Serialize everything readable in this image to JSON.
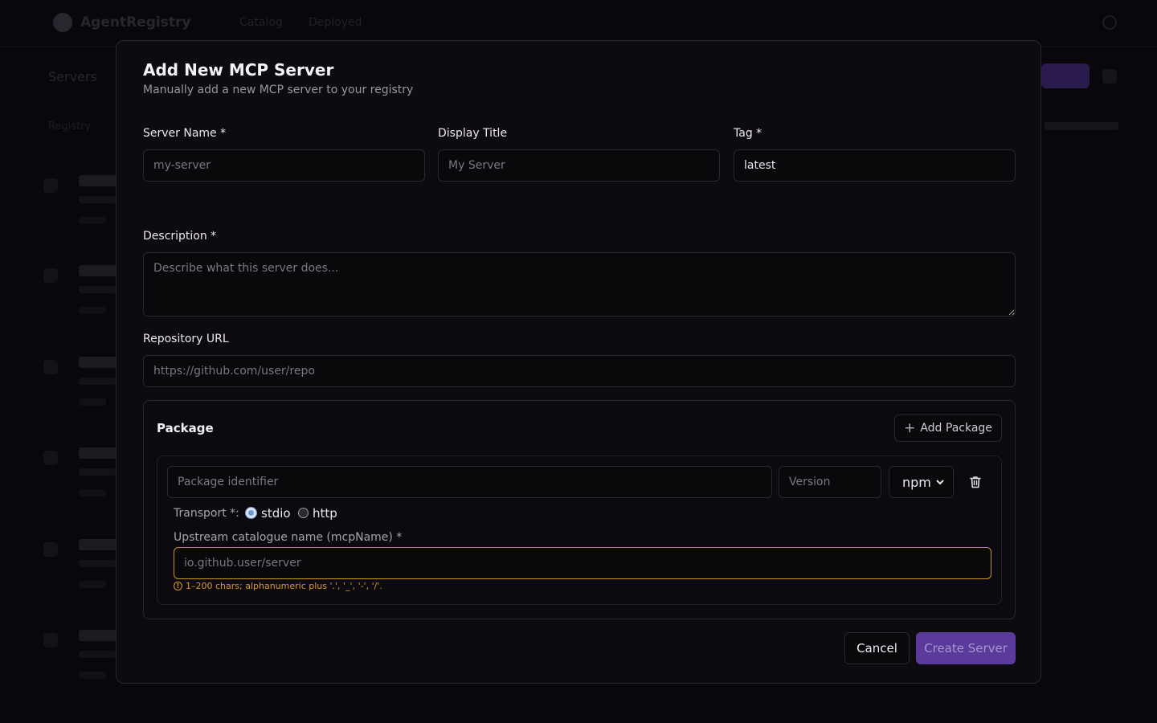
{
  "background": {
    "brand": "AgentRegistry",
    "nav": [
      "Catalog",
      "Deployed"
    ],
    "page_title": "Servers",
    "subtitle": "Registry"
  },
  "modal": {
    "title": "Add New MCP Server",
    "subtitle": "Manually add a new MCP server to your registry",
    "fields": {
      "server_name": {
        "label": "Server Name *",
        "placeholder": "my-server",
        "value": ""
      },
      "display_title": {
        "label": "Display Title",
        "placeholder": "My Server",
        "value": ""
      },
      "tag": {
        "label": "Tag *",
        "placeholder": "",
        "value": "latest"
      },
      "description": {
        "label": "Description *",
        "placeholder": "Describe what this server does...",
        "value": ""
      },
      "repository_url": {
        "label": "Repository URL",
        "placeholder": "https://github.com/user/repo",
        "value": ""
      }
    },
    "package": {
      "heading": "Package",
      "add_button": "Add Package",
      "identifier_placeholder": "Package identifier",
      "version_placeholder": "Version",
      "registry_type": "npm",
      "transport_label": "Transport *:",
      "transport_options": [
        "stdio",
        "http"
      ],
      "transport_selected": "stdio",
      "mcp_name_label": "Upstream catalogue name (mcpName) *",
      "mcp_name_placeholder": "io.github.user/server",
      "mcp_name_hint": "1–200 chars; alphanumeric plus '.', '_', '-', '/'."
    },
    "actions": {
      "cancel": "Cancel",
      "create": "Create Server"
    }
  },
  "colors": {
    "accent": "#5a3a9a",
    "warning": "#d99a27",
    "background": "#09070b"
  },
  "icons": {
    "add": "plus-icon",
    "delete": "trash-icon",
    "dropdown": "chevron-down-icon",
    "warning": "alert-circle-icon"
  }
}
